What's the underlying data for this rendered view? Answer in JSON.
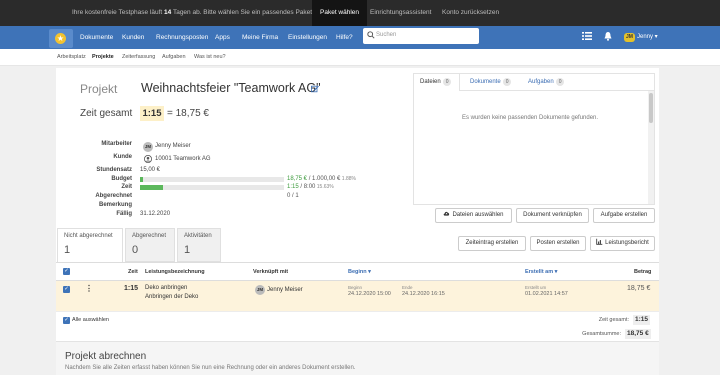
{
  "trial": {
    "msg_before": "Ihre kostenfreie Testphase läuft ",
    "msg_days": "14",
    "msg_after": " Tagen ab. Bitte wählen Sie ein passendes Paket.",
    "btn_paket": "Paket wählen",
    "btn_assistent": "Einrichtungsassistent",
    "btn_reset": "Konto zurücksetzen"
  },
  "nav": {
    "items": [
      "Dokumente",
      "Kunden",
      "Rechnungsposten",
      "Apps",
      "Meine Firma",
      "Einstellungen",
      "Hilfe?"
    ],
    "search_placeholder": "Suchen",
    "user_initials": "JM",
    "user_name": "Jenny"
  },
  "subnav": [
    "Arbeitsplatz",
    "Projekte",
    "Zeiterfassung",
    "Aufgaben",
    "Was ist neu?"
  ],
  "project": {
    "label": "Projekt",
    "name": "Weihnachtsfeier \"Teamwork AG\"",
    "zeit_label": "Zeit gesamt",
    "zeit_value": "1:15",
    "zeit_eq": "= 18,75 €"
  },
  "details": {
    "mitarbeiter_label": "Mitarbeiter",
    "mitarbeiter_initials": "JM",
    "mitarbeiter_value": "Jenny Meiser",
    "kunde_label": "Kunde",
    "kunde_value": "10001 Teamwork AG",
    "stundensatz_label": "Stundensatz",
    "stundensatz_value": "15,00 €",
    "budget_label": "Budget",
    "budget_used": "18,75 €",
    "budget_total": " / 1.000,00 €",
    "budget_pct": " 1.88%",
    "budget_fraction": 0.0188,
    "zeit_label": "Zeit",
    "zeit_used": "1:15",
    "zeit_total": " / 8:00",
    "zeit_pct": " 15.63%",
    "zeit_fraction": 0.1563,
    "abgerechnet_label": "Abgerechnet",
    "abgerechnet_value": "0 / 1",
    "bemerkung_label": "Bemerkung",
    "faellig_label": "Fällig",
    "faellig_value": "31.12.2020"
  },
  "rpanel": {
    "tabs": [
      {
        "label": "Dateien",
        "count": "0"
      },
      {
        "label": "Dokumente",
        "count": "0"
      },
      {
        "label": "Aufgaben",
        "count": "0"
      }
    ],
    "empty_text": "Es wurden keine passenden Dokumente gefunden."
  },
  "actions": {
    "dateien": "Dateien auswählen",
    "dokument": "Dokument verknüpfen",
    "aufgabe": "Aufgabe erstellen",
    "zeiteintrag": "Zeiteintrag erstellen",
    "posten": "Posten erstellen",
    "leistungsbericht": "Leistungsbericht"
  },
  "ltabs": [
    {
      "label": "Nicht abgerechnet",
      "count": "1"
    },
    {
      "label": "Abgerechnet",
      "count": "0"
    },
    {
      "label": "Aktivitäten",
      "count": "1"
    }
  ],
  "table": {
    "headers": {
      "zeit": "Zeit",
      "leistung": "Leistungsbezeichnung",
      "verknuepft": "Verknüpft mit",
      "beginn": "Beginn",
      "erstellt": "Erstellt am",
      "betrag": "Betrag"
    },
    "row": {
      "zeit": "1:15",
      "leistung1": "Deko anbringen",
      "leistung2": "Anbringen der Deko",
      "user_initials": "JM",
      "user": "Jenny Meiser",
      "beginn_label": "Beginn",
      "beginn": "24.12.2020 15:00",
      "ende_label": "Ende",
      "ende": "24.12.2020 16:15",
      "erstellt_label": "Erstellt um",
      "erstellt": "01.02.2021 14:57",
      "betrag": "18,75 €"
    },
    "select_all": "Alle auswählen",
    "sum_zeit_label": "Zeit gesamt:",
    "sum_zeit": "1:15",
    "sum_betrag_label": "Gesamtsumme:",
    "sum_betrag": "18,75 €"
  },
  "abrechnen": {
    "title": "Projekt abrechnen",
    "subtitle": "Nachdem Sie alle Zeiten erfasst haben können Sie nun eine Rechnung oder ein anderes Dokument erstellen."
  }
}
